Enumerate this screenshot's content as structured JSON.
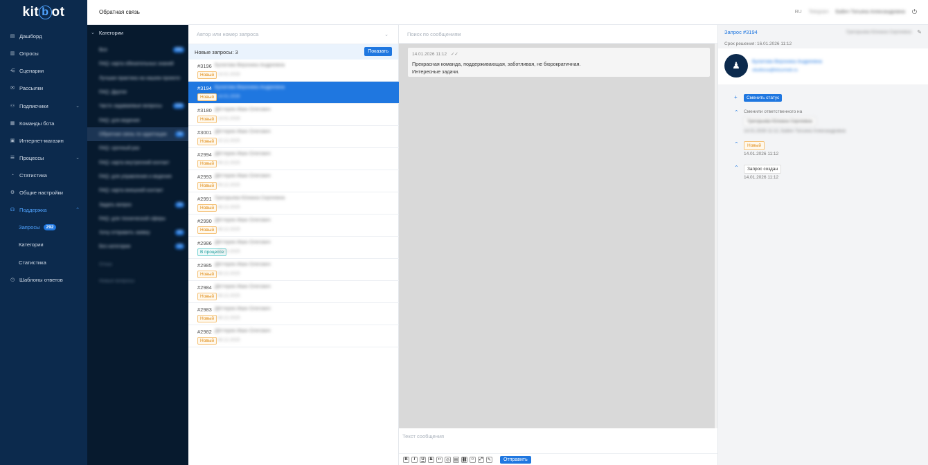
{
  "app": {
    "logo_left": "kit",
    "logo_mid": "b",
    "logo_right": "ot",
    "page_title": "Обратная связь"
  },
  "topbar": {
    "lang": "RU",
    "telegram": "Telegram",
    "user_name": "Байич Татьяна Александровна",
    "logout_icon": "logout-icon"
  },
  "nav": {
    "items": [
      {
        "label": "Дашборд",
        "icon": "dashboard-icon"
      },
      {
        "label": "Опросы",
        "icon": "chart-icon"
      },
      {
        "label": "Сценарии",
        "icon": "scenario-icon"
      },
      {
        "label": "Рассылки",
        "icon": "mail-icon"
      },
      {
        "label": "Подписчики",
        "icon": "users-icon"
      },
      {
        "label": "Команды бота",
        "icon": "commands-icon"
      },
      {
        "label": "Интернет-магазин",
        "icon": "shop-icon"
      },
      {
        "label": "Процессы",
        "icon": "process-icon"
      },
      {
        "label": "Статистика",
        "icon": "stats-icon"
      },
      {
        "label": "Общие настройки",
        "icon": "settings-icon"
      },
      {
        "label": "Поддержка",
        "icon": "support-icon"
      },
      {
        "label": "Запросы",
        "badge": "292"
      },
      {
        "label": "Категории"
      },
      {
        "label": "Статистика"
      },
      {
        "label": "Шаблоны ответов",
        "icon": "templates-icon"
      }
    ]
  },
  "categories": {
    "header": "Категории",
    "items": [
      {
        "label": "Все",
        "count": "292"
      },
      {
        "label": "FAQ: карта обязательных знаний",
        "count": ""
      },
      {
        "label": "Лучшая практика на нашем проекте",
        "count": ""
      },
      {
        "label": "FAQ: Другое",
        "count": ""
      },
      {
        "label": "Часто задаваемые вопросы",
        "count": "104"
      },
      {
        "label": "FAQ: для ведения",
        "count": ""
      },
      {
        "label": "Обратная связь по адаптации",
        "count": "34"
      },
      {
        "label": "FAQ: срочный раз",
        "count": ""
      },
      {
        "label": "FAQ: карта внутренний контакт",
        "count": ""
      },
      {
        "label": "FAQ: для управления и ведения",
        "count": ""
      },
      {
        "label": "FAQ: карта внешний контакт",
        "count": ""
      },
      {
        "label": "Задать вопрос",
        "count": "23"
      },
      {
        "label": "FAQ: для технической сферы",
        "count": ""
      },
      {
        "label": "Хочу отправить заявку",
        "count": "37"
      },
      {
        "label": "Без категории",
        "count": "12"
      },
      {
        "label": "Отказ",
        "count": ""
      },
      {
        "label": "Новые вопросы",
        "count": ""
      }
    ]
  },
  "list": {
    "search_placeholder": "Автор или номер запроса",
    "new_label": "Новые запросы: 3",
    "show_button": "Показать",
    "requests": [
      {
        "id": "#3196",
        "name": "Булатова Вероника Андреевна",
        "status": "Новый",
        "date": "14.01.2026"
      },
      {
        "id": "#3194",
        "name": "Булатова Вероника Андреевна",
        "status": "Новый",
        "date": "14.01.2026"
      },
      {
        "id": "#3180",
        "name": "Дёгтерев Иван Олегович",
        "status": "Новый",
        "date": "13.01.2026"
      },
      {
        "id": "#3001",
        "name": "Дёгтерев Иван Олегович",
        "status": "Новый",
        "date": "10.12.2025"
      },
      {
        "id": "#2994",
        "name": "Дёгтерев Иван Олегович",
        "status": "Новый",
        "date": "09.12.2025"
      },
      {
        "id": "#2993",
        "name": "Дёгтерев Иван Олегович",
        "status": "Новый",
        "date": "09.12.2025"
      },
      {
        "id": "#2991",
        "name": "Григорьева Юлиана Сергеевна",
        "status": "Новый",
        "date": "08.12.2025"
      },
      {
        "id": "#2990",
        "name": "Дёгтерев Иван Олегович",
        "status": "Новый",
        "date": "08.12.2025"
      },
      {
        "id": "#2986",
        "name": "Дёгтерев Иван Олегович",
        "status": "В процессе",
        "date": "08.12.2025"
      },
      {
        "id": "#2985",
        "name": "Дёгтерев Иван Олегович",
        "status": "Новый",
        "date": "08.12.2025"
      },
      {
        "id": "#2984",
        "name": "Дёгтерев Иван Олегович",
        "status": "Новый",
        "date": "08.12.2025"
      },
      {
        "id": "#2983",
        "name": "Дёгтерев Иван Олегович",
        "status": "Новый",
        "date": "08.12.2025"
      },
      {
        "id": "#2982",
        "name": "Дёгтерев Иван Олегович",
        "status": "Новый",
        "date": "08.12.2025"
      }
    ]
  },
  "chat": {
    "search_placeholder": "Поиск по сообщениям",
    "message": {
      "time": "14.01.2026 11:12",
      "text_line1": "Прекрасная команда, поддерживающая, заботливая, не бюрократичная.",
      "text_line2": "Интересные задачи."
    },
    "compose_placeholder": "Текст сообщения",
    "toolbar": [
      "B",
      "I",
      "U",
      "S",
      "‹›",
      "◎",
      "▤",
      "⛓",
      "☺",
      "⤢",
      "✎"
    ],
    "send_button": "Отправить"
  },
  "details": {
    "title": "Запрос #3194",
    "assignee": "Григорьева Юлиана Сергеевна",
    "due": "Срок решения: 16.01.2026 11:12",
    "user_name": "Булатова Вероника Андреевна",
    "user_email": "vbulitova@kitsomeb.ru",
    "change_status": "Сменить статус",
    "events": {
      "assignee_changed": "Сменили ответственного на",
      "assignee_chip": "Григорьева Юлиана Сергеевна",
      "assignee_meta": "14.01.2026 11:12, Байич Татьяна Александровна",
      "status_chip": "Новый",
      "status_date": "14.01.2026 11:12",
      "created_chip": "Запрос создан",
      "created_date": "14.01.2026 11:12"
    }
  }
}
